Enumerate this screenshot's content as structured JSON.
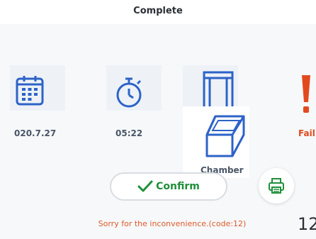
{
  "header": {
    "title": "Complete"
  },
  "info": {
    "date": "020.7.27",
    "time": "05:22",
    "status": "Fail"
  },
  "chamber": {
    "label": "Chamber"
  },
  "actions": {
    "confirm_label": "Confirm"
  },
  "error": {
    "message": "Sorry for the inconvenience.(code:12)"
  },
  "partial_text": "12",
  "icons": {
    "date": "calendar-icon",
    "time": "stopwatch-icon",
    "door": "door-icon",
    "status": "exclamation-icon",
    "chamber": "chamber-icon",
    "confirm": "check-icon",
    "print": "printer-icon"
  },
  "colors": {
    "accent_blue": "#2d63c8",
    "success_green": "#1f8f3a",
    "fail_red": "#e24a1e",
    "error_text": "#e05a2a"
  }
}
